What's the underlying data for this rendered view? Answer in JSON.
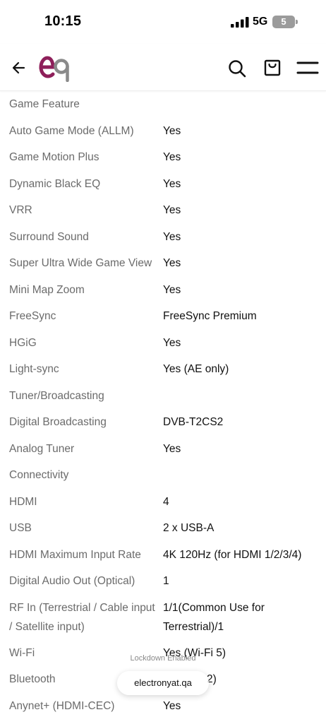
{
  "status_bar": {
    "time": "10:15",
    "network": "5G",
    "battery": "5"
  },
  "header": {
    "logo_text": "eq",
    "brand_color": "#8e1f5a",
    "icons": [
      "arrow-left-icon",
      "search-icon",
      "shopping-bag-icon",
      "hamburger-menu-icon"
    ]
  },
  "specs": {
    "game_feature": {
      "title": "Game Feature",
      "rows": [
        {
          "label": "Auto Game Mode (ALLM)",
          "value": "Yes"
        },
        {
          "label": "Game Motion Plus",
          "value": "Yes"
        },
        {
          "label": "Dynamic Black EQ",
          "value": "Yes"
        },
        {
          "label": "VRR",
          "value": "Yes"
        },
        {
          "label": "Surround Sound",
          "value": "Yes"
        },
        {
          "label": "Super Ultra Wide Game View",
          "value": "Yes"
        },
        {
          "label": "Mini Map Zoom",
          "value": "Yes"
        },
        {
          "label": "FreeSync",
          "value": "FreeSync Premium"
        },
        {
          "label": "HGiG",
          "value": "Yes"
        },
        {
          "label": "Light-sync",
          "value": "Yes (AE only)"
        }
      ]
    },
    "tuner": {
      "title": "Tuner/Broadcasting",
      "rows": [
        {
          "label": "Digital Broadcasting",
          "value": "DVB-T2CS2"
        },
        {
          "label": "Analog Tuner",
          "value": "Yes"
        }
      ]
    },
    "connectivity": {
      "title": "Connectivity",
      "rows": [
        {
          "label": "HDMI",
          "value": "4"
        },
        {
          "label": "USB",
          "value": "2 x USB-A"
        },
        {
          "label": "HDMI Maximum Input Rate",
          "value": "4K 120Hz (for HDMI 1/2/3/4)"
        },
        {
          "label": "Digital Audio Out (Optical)",
          "value": "1"
        },
        {
          "label": "RF In (Terrestrial / Cable input / Satellite input)",
          "value": "1/1(Common Use for Terrestrial)/1"
        },
        {
          "label": "Wi-Fi",
          "value": "Yes (Wi-Fi 5)"
        },
        {
          "label": "Bluetooth",
          "value": "2)"
        },
        {
          "label": "Anynet+ (HDMI-CEC)",
          "value": "Yes"
        }
      ]
    }
  },
  "bottom": {
    "lockdown": "Lockdown Enabled",
    "url": "electronyat.qa"
  }
}
